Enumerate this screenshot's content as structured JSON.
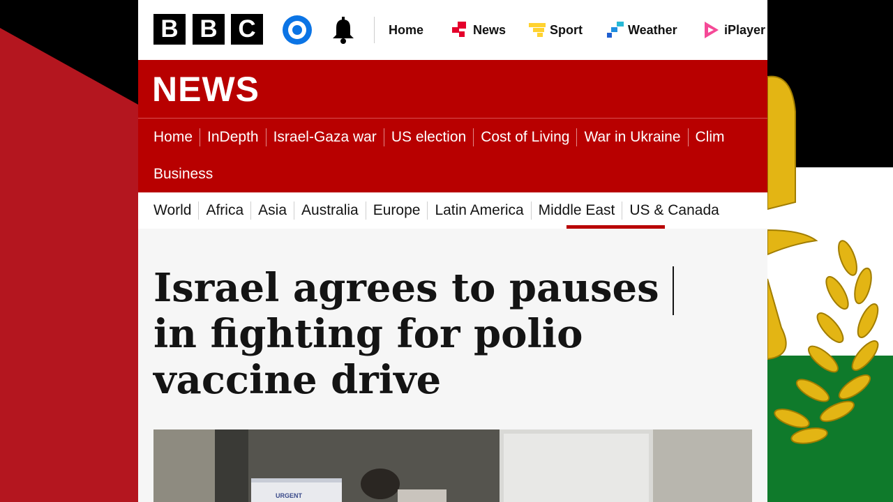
{
  "brand": {
    "letters": [
      "B",
      "B",
      "C"
    ]
  },
  "topnav": [
    {
      "label": "Home",
      "icon": "none"
    },
    {
      "label": "News",
      "icon": "news-icon",
      "color": "#e4002b"
    },
    {
      "label": "Sport",
      "icon": "sport-icon",
      "color": "#ffd230"
    },
    {
      "label": "Weather",
      "icon": "weather-icon",
      "color": "#1f8ee0"
    },
    {
      "label": "iPlayer",
      "icon": "iplayer-icon",
      "color": "#f54997"
    }
  ],
  "section": {
    "title": "NEWS",
    "nav": [
      "Home",
      "InDepth",
      "Israel-Gaza war",
      "US election",
      "Cost of Living",
      "War in Ukraine",
      "Clim"
    ],
    "nav_row2": "Business"
  },
  "subnav": {
    "items": [
      "World",
      "Africa",
      "Asia",
      "Australia",
      "Europe",
      "Latin America",
      "Middle East",
      "US & Canada"
    ],
    "active": "Middle East"
  },
  "article": {
    "headline": "Israel agrees to pauses in fighting for polio vaccine drive",
    "photo_label": "URGENT"
  },
  "colors": {
    "bbc_red": "#b80000",
    "account_blue": "#0b74e5"
  }
}
